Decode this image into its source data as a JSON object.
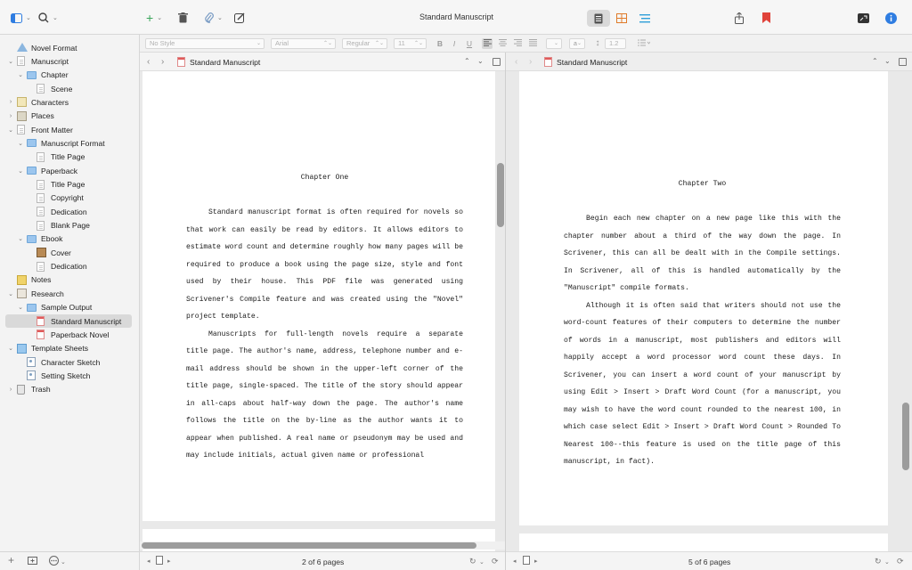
{
  "window": {
    "title": "Standard Manuscript"
  },
  "binder": {
    "items": [
      {
        "label": "Novel Format",
        "icon": "novel-format-icon",
        "disclosure": "",
        "level": 0,
        "type": "novel"
      },
      {
        "label": "Manuscript",
        "icon": "manuscript-icon",
        "disclosure": "⌄",
        "level": 0,
        "type": "doc"
      },
      {
        "label": "Chapter",
        "icon": "folder-icon",
        "disclosure": "⌄",
        "level": 1,
        "type": "folder"
      },
      {
        "label": "Scene",
        "icon": "document-icon",
        "disclosure": "",
        "level": 2,
        "type": "doc"
      },
      {
        "label": "Characters",
        "icon": "characters-icon",
        "disclosure": "›",
        "level": 0,
        "type": "chars"
      },
      {
        "label": "Places",
        "icon": "places-icon",
        "disclosure": "›",
        "level": 0,
        "type": "places"
      },
      {
        "label": "Front Matter",
        "icon": "front-matter-icon",
        "disclosure": "⌄",
        "level": 0,
        "type": "doc"
      },
      {
        "label": "Manuscript Format",
        "icon": "folder-icon",
        "disclosure": "⌄",
        "level": 1,
        "type": "folder"
      },
      {
        "label": "Title Page",
        "icon": "document-icon",
        "disclosure": "",
        "level": 2,
        "type": "doc"
      },
      {
        "label": "Paperback",
        "icon": "folder-icon",
        "disclosure": "⌄",
        "level": 1,
        "type": "folder"
      },
      {
        "label": "Title Page",
        "icon": "document-icon",
        "disclosure": "",
        "level": 2,
        "type": "doc"
      },
      {
        "label": "Copyright",
        "icon": "document-icon",
        "disclosure": "",
        "level": 2,
        "type": "doc"
      },
      {
        "label": "Dedication",
        "icon": "document-icon",
        "disclosure": "",
        "level": 2,
        "type": "doc"
      },
      {
        "label": "Blank Page",
        "icon": "document-icon",
        "disclosure": "",
        "level": 2,
        "type": "doc"
      },
      {
        "label": "Ebook",
        "icon": "folder-icon",
        "disclosure": "⌄",
        "level": 1,
        "type": "folder"
      },
      {
        "label": "Cover",
        "icon": "cover-image-icon",
        "disclosure": "",
        "level": 2,
        "type": "cover"
      },
      {
        "label": "Dedication",
        "icon": "document-icon",
        "disclosure": "",
        "level": 2,
        "type": "doc"
      },
      {
        "label": "Notes",
        "icon": "notes-icon",
        "disclosure": "",
        "level": 0,
        "type": "notes"
      },
      {
        "label": "Research",
        "icon": "research-icon",
        "disclosure": "⌄",
        "level": 0,
        "type": "research"
      },
      {
        "label": "Sample Output",
        "icon": "folder-icon",
        "disclosure": "⌄",
        "level": 1,
        "type": "folder"
      },
      {
        "label": "Standard Manuscript",
        "icon": "pdf-document-icon",
        "disclosure": "",
        "level": 2,
        "type": "docred",
        "selected": true
      },
      {
        "label": "Paperback Novel",
        "icon": "pdf-document-icon",
        "disclosure": "",
        "level": 2,
        "type": "docred"
      },
      {
        "label": "Template Sheets",
        "icon": "template-sheets-icon",
        "disclosure": "⌄",
        "level": 0,
        "type": "templates"
      },
      {
        "label": "Character Sketch",
        "icon": "sketch-icon",
        "disclosure": "",
        "level": 1,
        "type": "sketch"
      },
      {
        "label": "Setting Sketch",
        "icon": "sketch-icon",
        "disclosure": "",
        "level": 1,
        "type": "sketch"
      },
      {
        "label": "Trash",
        "icon": "trash-icon",
        "disclosure": "›",
        "level": 0,
        "type": "trash"
      }
    ]
  },
  "formatbar": {
    "style": "No Style",
    "font": "Arial",
    "weight": "Regular",
    "size": "11",
    "line_spacing": "1.2"
  },
  "left_editor": {
    "title": "Standard Manuscript",
    "chapter_heading": "Chapter One",
    "paragraphs": [
      "Standard manuscript format is often required for novels so that work can easily be read by editors. It allows editors to estimate word count and determine roughly how many pages will be required to produce a book using the page size, style and font used by their house. This PDF file was generated using Scrivener's Compile feature and was created using the \"Novel\" project template.",
      "Manuscripts for full-length novels require a separate title page. The author's name, address, telephone number and e-mail address should be shown in the upper-left corner of the title page, single-spaced. The title of the story should appear in all-caps about half-way down the page. The author's name follows the title on the by-line as the author wants it to appear when published. A real name or pseudonym may be used and may include initials, actual given name or professional"
    ],
    "page_status": "2 of 6 pages"
  },
  "right_editor": {
    "title": "Standard Manuscript",
    "chapter_heading": "Chapter Two",
    "paragraphs": [
      "Begin each new chapter on a new page like this with the chapter number about a third of the way down the page. In Scrivener, this can all be dealt with in the Compile settings. In Scrivener, all of this is handled automatically by the \"Manuscript\" compile formats.",
      "Although it is often said that writers should not use the word-count features of their computers to determine the number of words in a manuscript, most publishers and editors will happily accept a word processor word count these days. In Scrivener, you can insert a word count of your manuscript by using Edit > Insert > Draft Word Count (for a manuscript, you may wish to have the word count rounded to the nearest 100, in which case select Edit > Insert > Draft Word Count > Rounded To Nearest 100--this feature is used on the title page of this manuscript, in fact)."
    ],
    "page_status": "5 of 6 pages"
  },
  "colors": {
    "accent": "#2f7de1",
    "bookmark": "#e0433b",
    "selection": "#d9d9d9"
  }
}
